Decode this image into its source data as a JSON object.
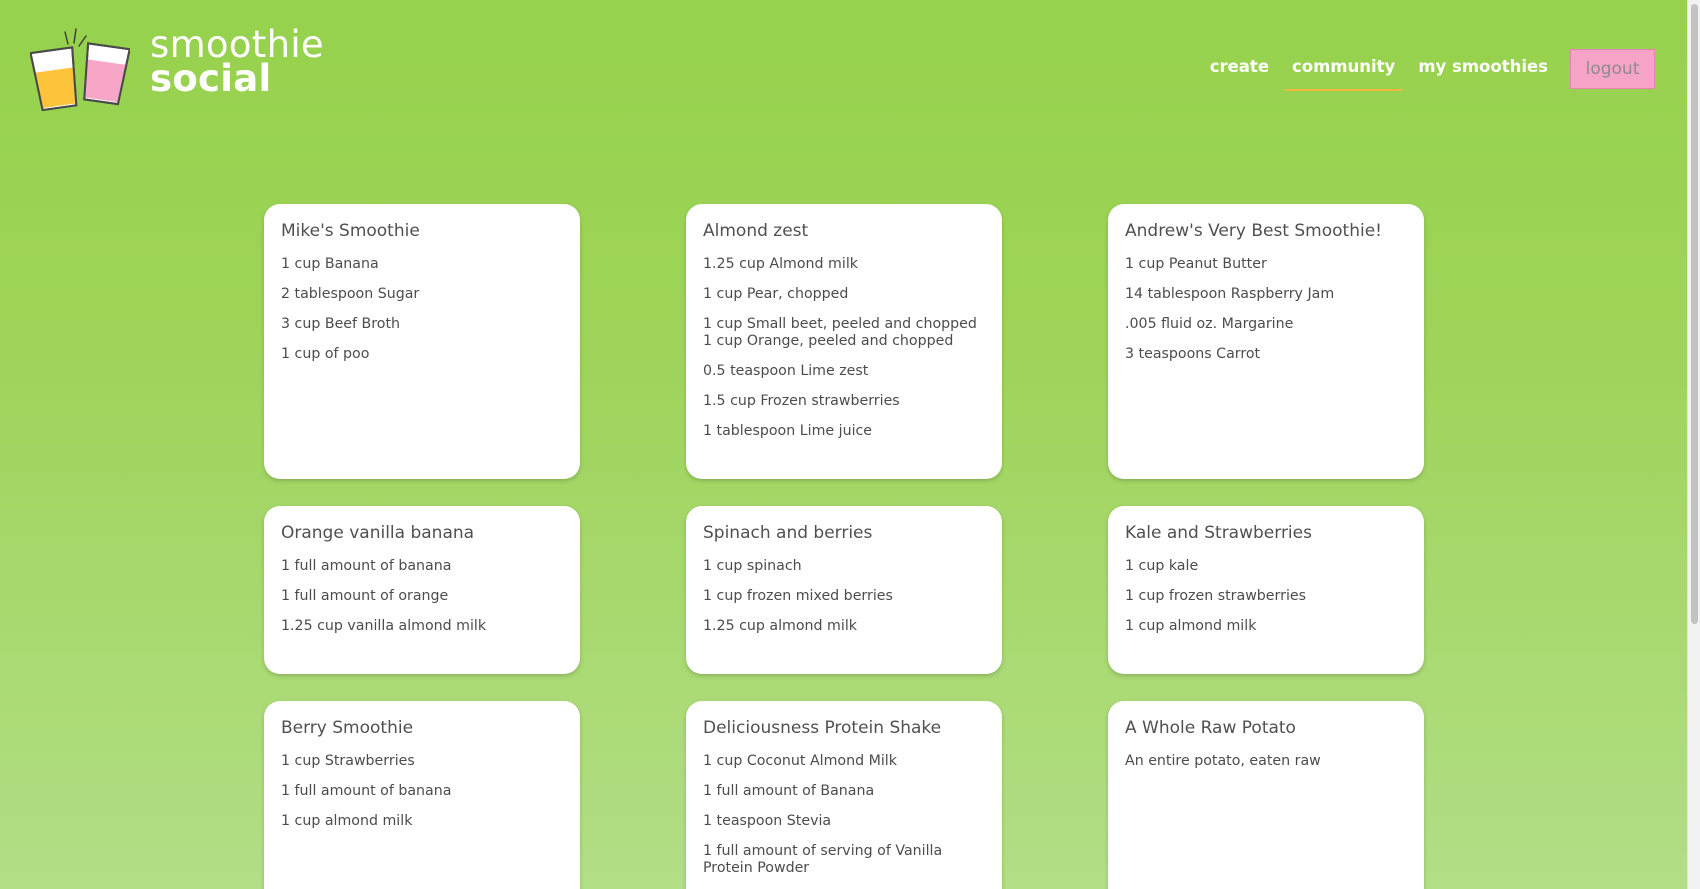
{
  "brand": {
    "line1": "smoothie",
    "line2": "social"
  },
  "nav": {
    "create": "create",
    "community": "community",
    "my_smoothies": "my smoothies",
    "logout": "logout"
  },
  "colors": {
    "background_top": "#96d24c",
    "background_bottom": "#b2de86",
    "nav_active_underline": "#f4b942",
    "logout_bg": "#f5a3c7",
    "glass_yellow": "#fdc33b",
    "glass_pink": "#f7a6c8"
  },
  "icons": {
    "logo": "two-glasses-cheers-icon"
  },
  "smoothies": [
    {
      "title": "Mike's Smoothie",
      "ingredients": [
        "1 cup Banana",
        "2 tablespoon Sugar",
        "3 cup Beef Broth",
        "1 cup of poo"
      ]
    },
    {
      "title": "Almond zest",
      "ingredients": [
        "1.25 cup Almond milk",
        "1 cup Pear, chopped",
        "1 cup Small beet, peeled and chopped 1 cup Orange, peeled and chopped",
        "0.5 teaspoon Lime zest",
        "1.5 cup Frozen strawberries",
        "1 tablespoon Lime juice"
      ]
    },
    {
      "title": "Andrew's Very Best Smoothie!",
      "ingredients": [
        "1 cup Peanut Butter",
        "14 tablespoon Raspberry Jam",
        ".005 fluid oz. Margarine",
        "3 teaspoons Carrot"
      ]
    },
    {
      "title": "Orange vanilla banana",
      "ingredients": [
        "1 full amount of banana",
        "1 full amount of orange",
        "1.25 cup vanilla almond milk"
      ]
    },
    {
      "title": "Spinach and berries",
      "ingredients": [
        "1 cup spinach",
        "1 cup frozen mixed berries",
        "1.25 cup almond milk"
      ]
    },
    {
      "title": "Kale and Strawberries",
      "ingredients": [
        "1 cup kale",
        "1 cup frozen strawberries",
        "1 cup almond milk"
      ]
    },
    {
      "title": "Berry Smoothie",
      "ingredients": [
        "1 cup Strawberries",
        "1 full amount of banana",
        "1 cup almond milk"
      ]
    },
    {
      "title": "Deliciousness Protein Shake",
      "ingredients": [
        "1 cup Coconut Almond Milk",
        "1 full amount of Banana",
        "1 teaspoon Stevia",
        "1 full amount of serving of Vanilla Protein Powder"
      ]
    },
    {
      "title": "A Whole Raw Potato",
      "ingredients": [
        "An entire potato, eaten raw"
      ]
    }
  ]
}
